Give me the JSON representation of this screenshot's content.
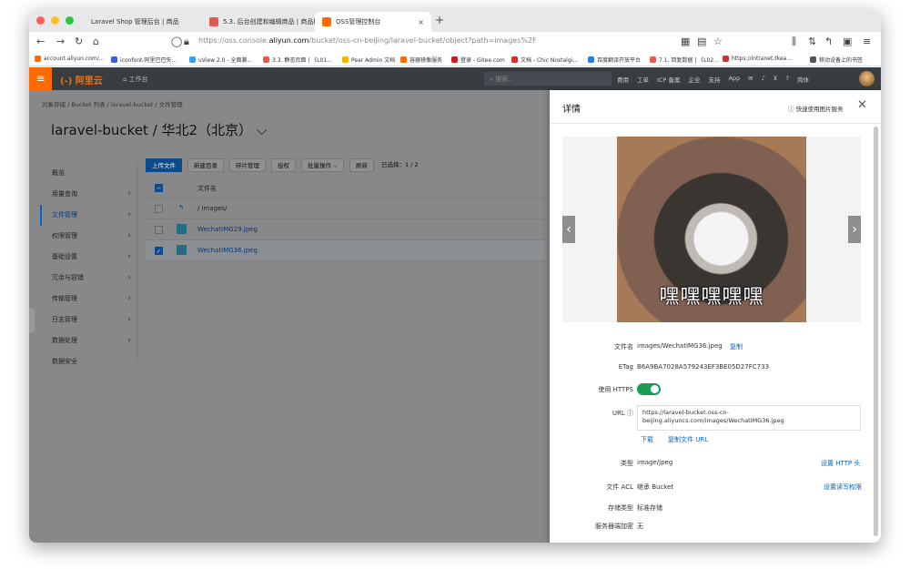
{
  "browser": {
    "tabs": [
      {
        "label": "Laravel Shop 管理后台 | 商品"
      },
      {
        "label": "5.3. 后台创建和编辑商品 | 商品模 ×"
      },
      {
        "label": "OSS管理控制台"
      }
    ],
    "new_tab": "+",
    "url_prefix": "https://oss.console.",
    "url_domain": "aliyun.com",
    "url_path": "/bucket/oss-cn-beijing/laravel-bucket/object?path=images%2F",
    "bookmarks": [
      "account.aliyun.com/...",
      "iconfont-阿里巴巴矢...",
      "uView 2.0 - 全面兼...",
      "3.3. 静态页面 | 《L01...",
      "Pear Admin 文档",
      "容器镜像服务",
      "登录 - Gitee.com",
      "文档 - Chic Nostalgi...",
      "百度翻译开放平台",
      "7.1. 回复数据 | 《L02...",
      "https://intranet.tkea...",
      "移动设备上的书签"
    ]
  },
  "header": {
    "logo": "(-) 阿里云",
    "workbench": "工作台",
    "search_placeholder": "搜索...",
    "links": [
      "费用",
      "工单",
      "ICP 备案",
      "企业",
      "支持",
      "App",
      "简体"
    ]
  },
  "breadcrumb": "对象存储 / Bucket 列表 / laravel-bucket / 文件管理",
  "bucket_title": "laravel-bucket / 华北2（北京） ⌵",
  "menu": [
    {
      "label": "概览",
      "arrow": ""
    },
    {
      "label": "用量查询",
      "arrow": "›"
    },
    {
      "label": "文件管理",
      "arrow": "›"
    },
    {
      "label": "权限管理",
      "arrow": "›"
    },
    {
      "label": "基础设置",
      "arrow": "›"
    },
    {
      "label": "冗余与容错",
      "arrow": "›"
    },
    {
      "label": "传输管理",
      "arrow": "›"
    },
    {
      "label": "日志管理",
      "arrow": "›"
    },
    {
      "label": "数据处理",
      "arrow": "›"
    },
    {
      "label": "数据安全",
      "arrow": ""
    }
  ],
  "toolbar": {
    "upload": "上传文件",
    "new_dir": "新建目录",
    "fragments": "碎片管理",
    "authorize": "授权",
    "batch": "批量操作 ⌵",
    "refresh": "刷新",
    "selected": "已选择：1 / 2"
  },
  "table": {
    "header": "文件名",
    "back": "/ images/",
    "files": [
      "WechatIMG29.jpeg",
      "WechatIMG36.jpeg"
    ]
  },
  "detail": {
    "title": "详情",
    "quick_link": "快速使用图片服务",
    "meme_text": "嘿嘿嘿嘿嘿",
    "filename_label": "文件名",
    "filename": "images/WechatIMG36.jpeg",
    "copy": "复制",
    "etag_label": "ETag",
    "etag": "B6A9BA7028A579243EF3BE05D27FC733",
    "https_label": "使用 HTTPS",
    "url_label": "URL",
    "url": "https://laravel-bucket.oss-cn-beijing.aliyuncs.com/images/WechatIMG36.jpeg",
    "download": "下载",
    "copy_url": "复制文件 URL",
    "type_label": "类型",
    "type": "image/jpeg",
    "set_http_header": "设置 HTTP 头",
    "acl_label": "文件 ACL",
    "acl": "继承 Bucket",
    "set_acl": "设置读写权限",
    "storage_label": "存储类型",
    "storage": "标准存储",
    "encryption_label": "服务器端加密",
    "encryption": "无"
  }
}
